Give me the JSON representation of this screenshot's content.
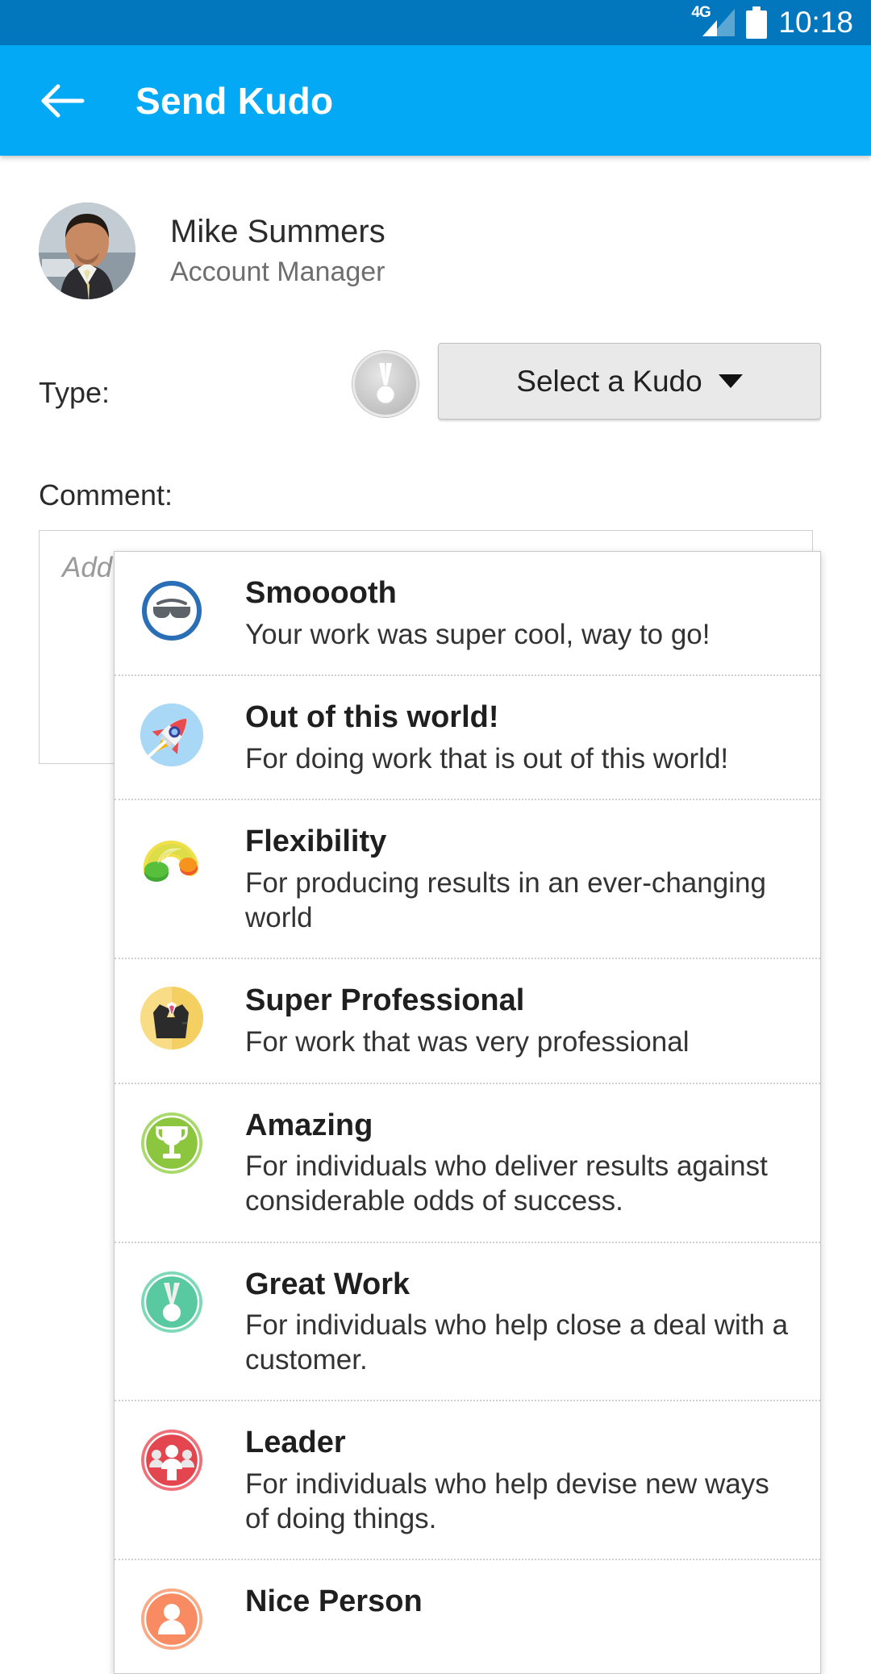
{
  "status_bar": {
    "network_label": "4G",
    "battery_icon": "battery-full-icon",
    "signal_icon": "signal-bars-icon",
    "time": "10:18"
  },
  "app_bar": {
    "back_icon": "back-arrow-icon",
    "title": "Send Kudo",
    "background_color": "#03A9F4"
  },
  "profile": {
    "avatar_icon": "user-photo-avatar",
    "name": "Mike Summers",
    "role": "Account Manager"
  },
  "form": {
    "type_label": "Type:",
    "badge_icon": "medal-badge-icon",
    "select_kudo_label": "Select a Kudo",
    "caret_icon": "chevron-down-icon",
    "comment_label": "Comment:",
    "comment_value": "",
    "comment_placeholder": "Add a comment"
  },
  "dropdown": {
    "items": [
      {
        "title": "Smooooth",
        "description": "Your work was super cool, way to go!",
        "icon": "sunglasses-icon",
        "icon_bg": "#ffffff",
        "icon_ring": "#2a6fb5"
      },
      {
        "title": "Out of this world!",
        "description": "For doing work that is out of this world!",
        "icon": "rocket-icon",
        "icon_bg": "#a8d8f5",
        "icon_ring": "#a8d8f5"
      },
      {
        "title": "Flexibility",
        "description": "For producing results in an ever-changing world",
        "icon": "slinky-spring-icon",
        "icon_bg": "#ffffff",
        "icon_ring": "#ffffff"
      },
      {
        "title": "Super Professional",
        "description": "For work that was very professional",
        "icon": "suit-tuxedo-icon",
        "icon_bg": "#f7d873",
        "icon_ring": "#f7d873"
      },
      {
        "title": "Amazing",
        "description": "For individuals who deliver results against considerable odds of success.",
        "icon": "trophy-icon",
        "icon_bg": "#8cc63f",
        "icon_ring": "#a8d96a"
      },
      {
        "title": "Great Work",
        "description": "For individuals who help close a deal with a customer.",
        "icon": "medal-icon",
        "icon_bg": "#58c9a0",
        "icon_ring": "#7ed9b8"
      },
      {
        "title": "Leader",
        "description": "For individuals who help devise new ways of doing things.",
        "icon": "team-group-icon",
        "icon_bg": "#e3464f",
        "icon_ring": "#ef7078"
      },
      {
        "title": "Nice Person",
        "description": "",
        "icon": "smiley-person-icon",
        "icon_bg": "#f98b62",
        "icon_ring": "#fba884"
      }
    ]
  }
}
